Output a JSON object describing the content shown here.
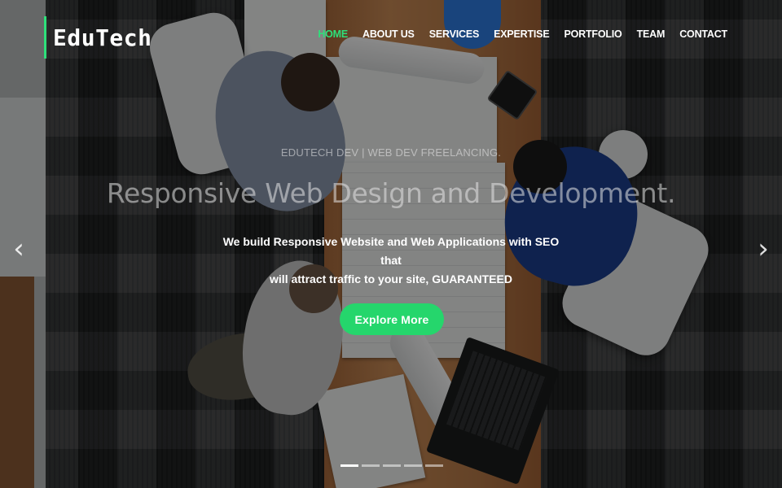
{
  "brand": {
    "name": "EduTech",
    "accent_color": "#2ee07a"
  },
  "nav": {
    "items": [
      {
        "label": "HOME",
        "active": true
      },
      {
        "label": "ABOUT US",
        "active": false
      },
      {
        "label": "SERVICES",
        "active": false
      },
      {
        "label": "EXPERTISE",
        "active": false
      },
      {
        "label": "PORTFOLIO",
        "active": false
      },
      {
        "label": "TEAM",
        "active": false
      },
      {
        "label": "CONTACT",
        "active": false
      }
    ]
  },
  "hero": {
    "kicker": "EDUTECH DEV | WEB DEV FREELANCING.",
    "headline": "Responsive Web Design and Development.",
    "desc_line1": "We build Responsive Website and Web Applications with SEO that",
    "desc_line2": "will attract traffic to your site, ",
    "desc_strong": "GUARANTEED",
    "cta_label": "Explore More",
    "cta_color": "#25d66c"
  },
  "carousel": {
    "prev_icon": "chevron-left-icon",
    "next_icon": "chevron-right-icon",
    "prev_glyph": "‹",
    "next_glyph": "›",
    "slide_count": 5,
    "active_index": 0
  }
}
